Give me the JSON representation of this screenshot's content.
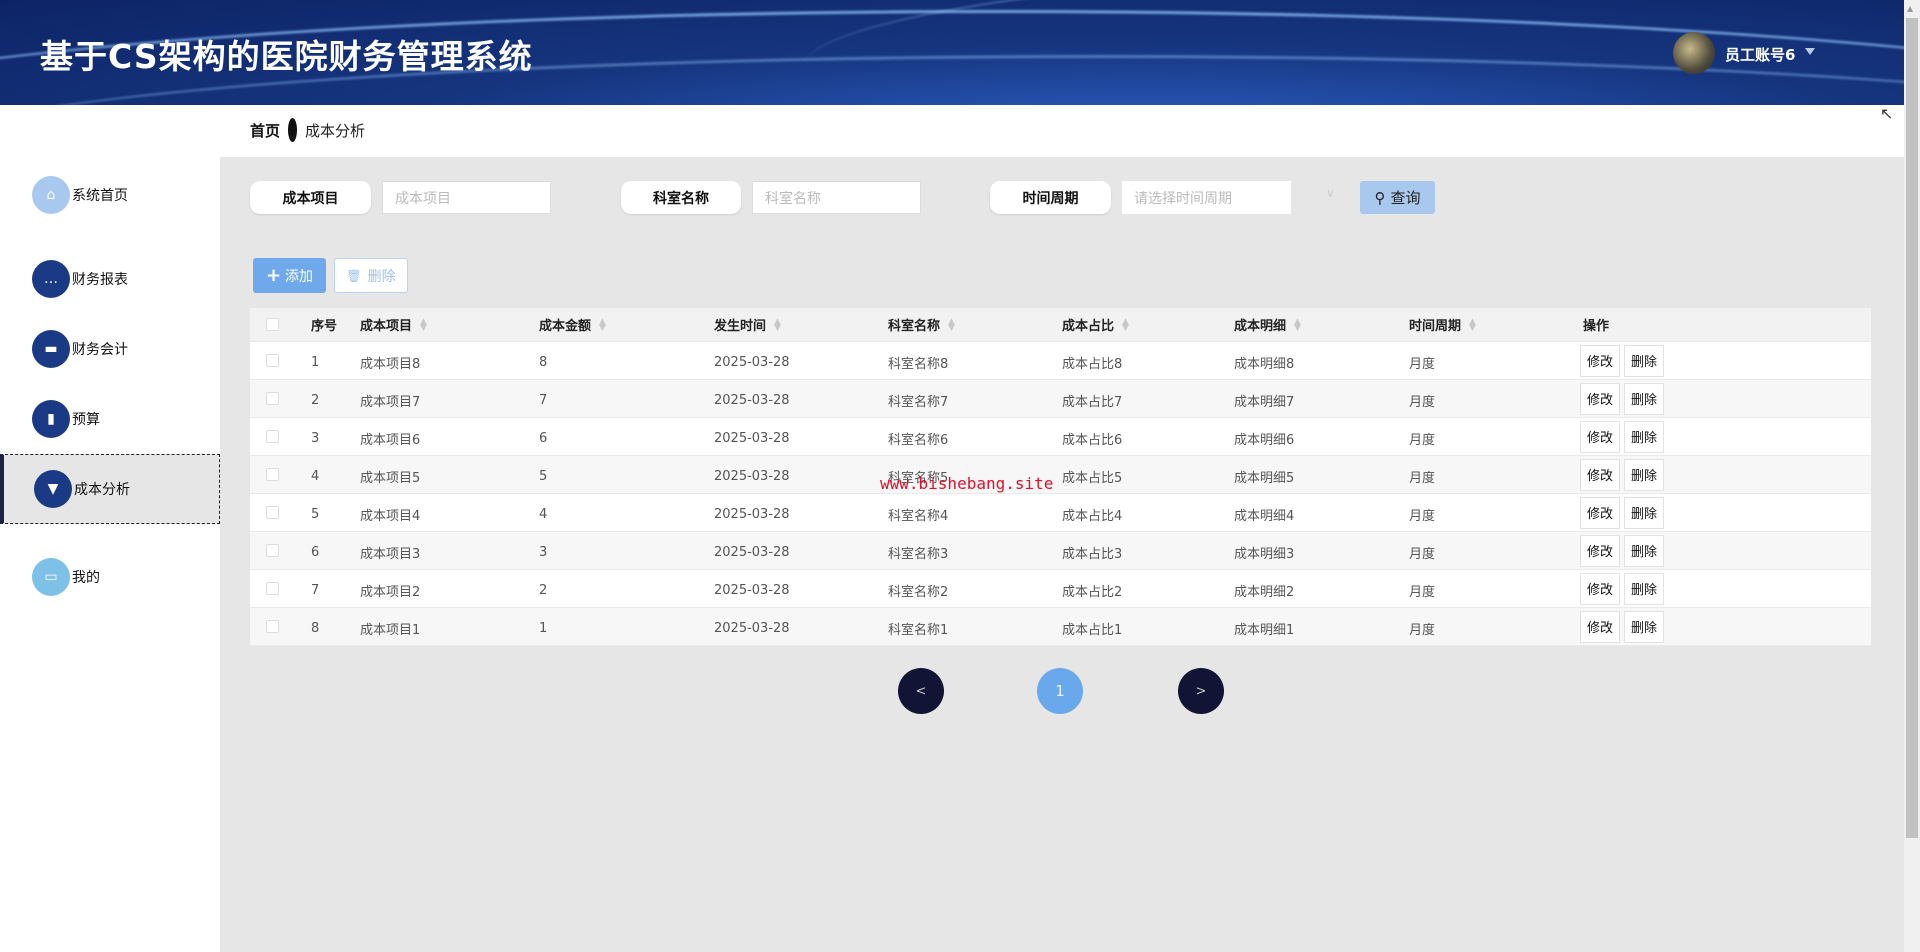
{
  "header": {
    "title": "基于CS架构的医院财务管理系统",
    "user": "员工账号6"
  },
  "breadcrumb": {
    "home": "首页",
    "current": "成本分析"
  },
  "sidebar": {
    "items": [
      {
        "label": "系统首页",
        "icon": "home-icon"
      },
      {
        "label": "财务报表",
        "icon": "chat-icon"
      },
      {
        "label": "财务会计",
        "icon": "wallet-icon"
      },
      {
        "label": "预算",
        "icon": "bar-chart-icon"
      },
      {
        "label": "成本分析",
        "icon": "brush-icon",
        "active": true
      },
      {
        "label": "我的",
        "icon": "card-icon"
      }
    ]
  },
  "search": {
    "item_label": "成本项目",
    "item_placeholder": "成本项目",
    "dept_label": "科室名称",
    "dept_placeholder": "科室名称",
    "period_label": "时间周期",
    "period_placeholder": "请选择时间周期",
    "query": "查询"
  },
  "actions": {
    "add": "添加",
    "delete": "删除"
  },
  "table": {
    "headers": [
      "序号",
      "成本项目",
      "成本金额",
      "发生时间",
      "科室名称",
      "成本占比",
      "成本明细",
      "时间周期",
      "操作"
    ],
    "edit": "修改",
    "remove": "删除",
    "rows": [
      [
        "1",
        "成本项目8",
        "8",
        "2025-03-28",
        "科室名称8",
        "成本占比8",
        "成本明细8",
        "月度"
      ],
      [
        "2",
        "成本项目7",
        "7",
        "2025-03-28",
        "科室名称7",
        "成本占比7",
        "成本明细7",
        "月度"
      ],
      [
        "3",
        "成本项目6",
        "6",
        "2025-03-28",
        "科室名称6",
        "成本占比6",
        "成本明细6",
        "月度"
      ],
      [
        "4",
        "成本项目5",
        "5",
        "2025-03-28",
        "科室名称5",
        "成本占比5",
        "成本明细5",
        "月度"
      ],
      [
        "5",
        "成本项目4",
        "4",
        "2025-03-28",
        "科室名称4",
        "成本占比4",
        "成本明细4",
        "月度"
      ],
      [
        "6",
        "成本项目3",
        "3",
        "2025-03-28",
        "科室名称3",
        "成本占比3",
        "成本明细3",
        "月度"
      ],
      [
        "7",
        "成本项目2",
        "2",
        "2025-03-28",
        "科室名称2",
        "成本占比2",
        "成本明细2",
        "月度"
      ],
      [
        "8",
        "成本项目1",
        "1",
        "2025-03-28",
        "科室名称1",
        "成本占比1",
        "成本明细1",
        "月度"
      ]
    ]
  },
  "pagination": {
    "prev": "<",
    "current": "1",
    "next": ">"
  },
  "watermark": "www.bishebang.site"
}
